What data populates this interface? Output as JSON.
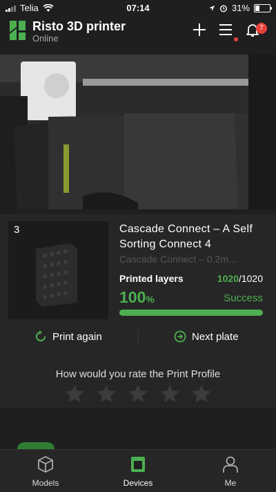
{
  "status_bar": {
    "carrier": "Telia",
    "time": "07:14",
    "battery": "31%"
  },
  "header": {
    "title": "Risto 3D printer",
    "subtitle": "Online",
    "notification_count": "7"
  },
  "job": {
    "plate_number": "3",
    "title": "Cascade Connect – A Self Sorting Connect 4",
    "subtitle": "Cascade Connect – 0.2m...",
    "layers_label": "Printed layers",
    "layers_done": "1020",
    "layers_total": "/1020",
    "percent": "100",
    "percent_unit": "%",
    "status": "Success",
    "progress": 1.0
  },
  "actions": {
    "print_again": "Print again",
    "next_plate": "Next plate"
  },
  "rating": {
    "question": "How would you rate the Print Profile",
    "stars": 5,
    "selected": 0
  },
  "tabs": [
    {
      "label": "Models",
      "icon": "models-icon"
    },
    {
      "label": "Devices",
      "icon": "devices-icon"
    },
    {
      "label": "Me",
      "icon": "profile-icon"
    }
  ],
  "colors": {
    "accent": "#4caf50",
    "background": "#1f1f1f",
    "card": "#262626",
    "badge": "#e8403b"
  }
}
